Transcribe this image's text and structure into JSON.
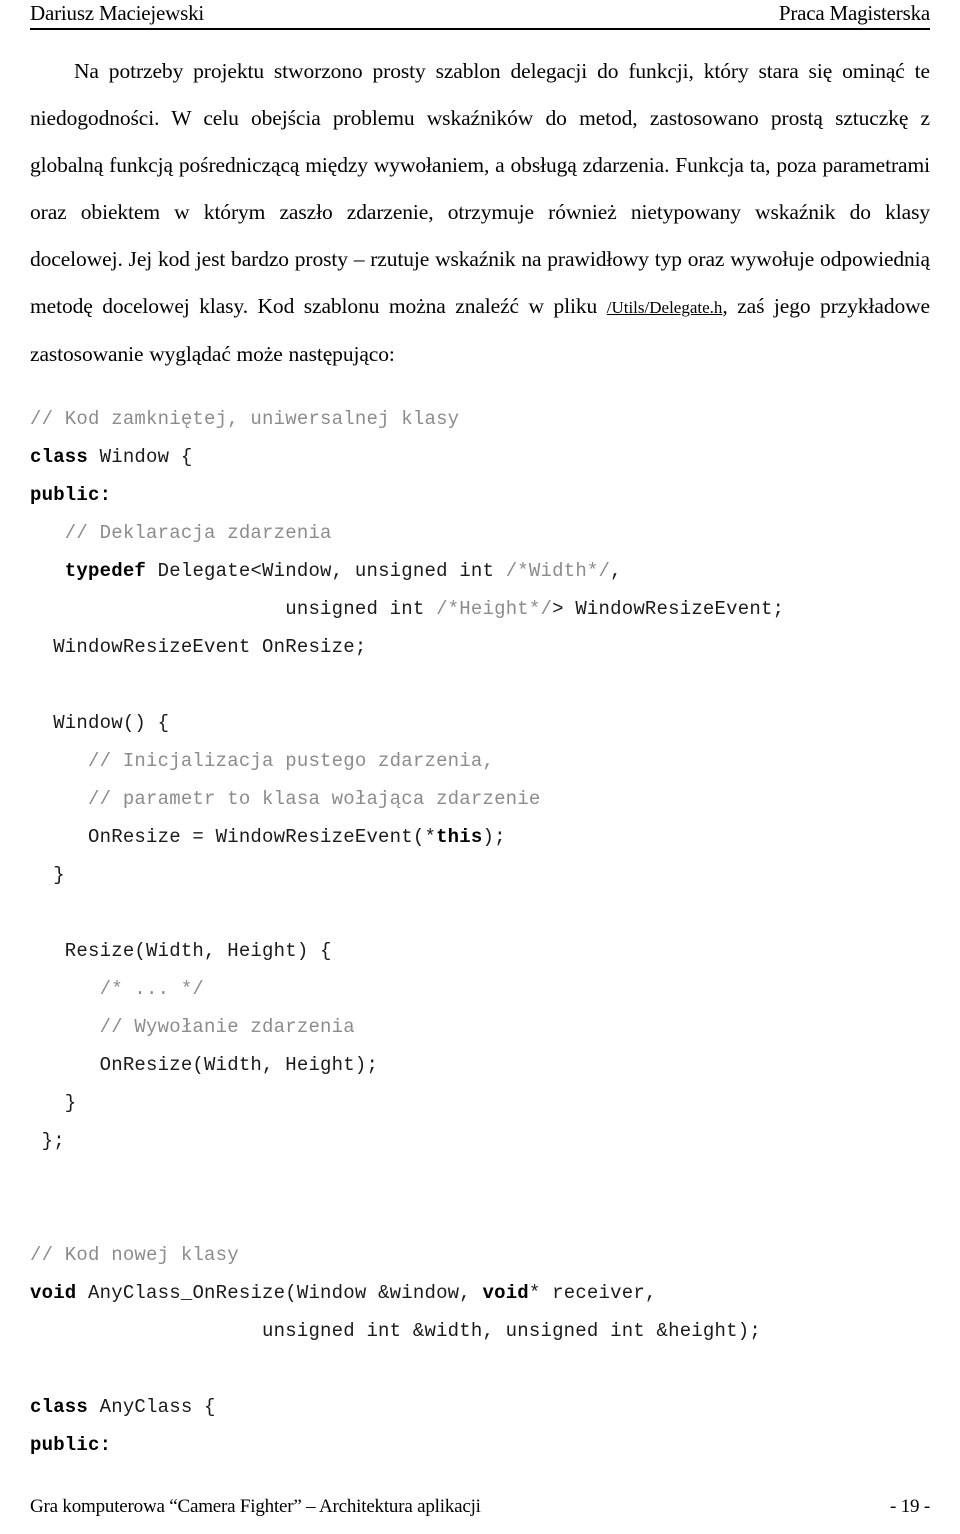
{
  "header": {
    "left": "Dariusz Maciejewski",
    "right": "Praca Magisterska"
  },
  "body": {
    "paragraph_part1": "Na potrzeby projektu stworzono prosty szablon delegacji do funkcji, który stara się ominąć te niedogodności. W celu obejścia problemu wskaźników do metod, zastosowano prostą sztuczkę z globalną funkcją pośredniczącą między wywołaniem, a obsługą zdarzenia. Funkcja ta, poza parametrami oraz obiektem w którym zaszło zdarzenie, otrzymuje również nietypowany wskaźnik do klasy docelowej. Jej kod jest bardzo prosty – rzutuje wskaźnik na prawidłowy typ oraz wywołuje odpowiednią metodę docelowej klasy. Kod szablonu można znaleźć w pliku ",
    "file_reference": "/Utils/Delegate.h",
    "paragraph_part2": ", zaś jego przykładowe zastosowanie wyglądać może następująco:"
  },
  "code": {
    "lines": [
      {
        "indent": 0,
        "segments": [
          {
            "style": "cmt",
            "text": "// Kod zamkniętej, uniwersalnej klasy"
          }
        ]
      },
      {
        "indent": 0,
        "segments": [
          {
            "style": "kw",
            "text": "class"
          },
          {
            "style": "plain",
            "text": " Window {"
          }
        ]
      },
      {
        "indent": 0,
        "segments": [
          {
            "style": "kw",
            "text": "public:"
          }
        ]
      },
      {
        "indent": 3,
        "segments": [
          {
            "style": "cmt",
            "text": "// Deklaracja zdarzenia"
          }
        ]
      },
      {
        "indent": 3,
        "segments": [
          {
            "style": "kw",
            "text": "typedef"
          },
          {
            "style": "plain",
            "text": " Delegate<Window, unsigned int "
          },
          {
            "style": "cmt",
            "text": "/*Width*/"
          },
          {
            "style": "plain",
            "text": ","
          }
        ]
      },
      {
        "indent": 22,
        "segments": [
          {
            "style": "plain",
            "text": "unsigned int "
          },
          {
            "style": "cmt",
            "text": "/*Height*/"
          },
          {
            "style": "plain",
            "text": "> WindowResizeEvent;"
          }
        ]
      },
      {
        "indent": 2,
        "segments": [
          {
            "style": "plain",
            "text": "WindowResizeEvent OnResize;"
          }
        ]
      },
      {
        "indent": 0,
        "segments": [
          {
            "style": "plain",
            "text": ""
          }
        ]
      },
      {
        "indent": 2,
        "segments": [
          {
            "style": "plain",
            "text": "Window() {"
          }
        ]
      },
      {
        "indent": 5,
        "segments": [
          {
            "style": "cmt",
            "text": "// Inicjalizacja pustego zdarzenia,"
          }
        ]
      },
      {
        "indent": 5,
        "segments": [
          {
            "style": "cmt",
            "text": "// parametr to klasa wołająca zdarzenie"
          }
        ]
      },
      {
        "indent": 5,
        "segments": [
          {
            "style": "plain",
            "text": "OnResize = WindowResizeEvent(*"
          },
          {
            "style": "kw",
            "text": "this"
          },
          {
            "style": "plain",
            "text": ");"
          }
        ]
      },
      {
        "indent": 2,
        "segments": [
          {
            "style": "plain",
            "text": "}"
          }
        ]
      },
      {
        "indent": 0,
        "segments": [
          {
            "style": "plain",
            "text": ""
          }
        ]
      },
      {
        "indent": 3,
        "segments": [
          {
            "style": "plain",
            "text": "Resize(Width, Height) {"
          }
        ]
      },
      {
        "indent": 6,
        "segments": [
          {
            "style": "cmt",
            "text": "/* ... */"
          }
        ]
      },
      {
        "indent": 6,
        "segments": [
          {
            "style": "cmt",
            "text": "// Wywołanie zdarzenia"
          }
        ]
      },
      {
        "indent": 6,
        "segments": [
          {
            "style": "plain",
            "text": "OnResize(Width, Height);"
          }
        ]
      },
      {
        "indent": 3,
        "segments": [
          {
            "style": "plain",
            "text": "}"
          }
        ]
      },
      {
        "indent": 1,
        "segments": [
          {
            "style": "plain",
            "text": "};"
          }
        ]
      },
      {
        "indent": 0,
        "segments": [
          {
            "style": "plain",
            "text": ""
          }
        ]
      },
      {
        "indent": 0,
        "segments": [
          {
            "style": "plain",
            "text": ""
          }
        ]
      },
      {
        "indent": 0,
        "segments": [
          {
            "style": "cmt",
            "text": "// Kod nowej klasy"
          }
        ]
      },
      {
        "indent": 0,
        "segments": [
          {
            "style": "kw",
            "text": "void"
          },
          {
            "style": "plain",
            "text": " AnyClass_OnResize(Window &window, "
          },
          {
            "style": "kw",
            "text": "void"
          },
          {
            "style": "plain",
            "text": "* receiver,"
          }
        ]
      },
      {
        "indent": 20,
        "segments": [
          {
            "style": "plain",
            "text": "unsigned int &width, unsigned int &height);"
          }
        ]
      },
      {
        "indent": 0,
        "segments": [
          {
            "style": "plain",
            "text": ""
          }
        ]
      },
      {
        "indent": 0,
        "segments": [
          {
            "style": "kw",
            "text": "class"
          },
          {
            "style": "plain",
            "text": " AnyClass {"
          }
        ]
      },
      {
        "indent": 0,
        "segments": [
          {
            "style": "kw",
            "text": "public:"
          }
        ]
      }
    ]
  },
  "footer": {
    "left": "Gra komputerowa “Camera Fighter” – Architektura aplikacji",
    "right": "- 19 -"
  }
}
